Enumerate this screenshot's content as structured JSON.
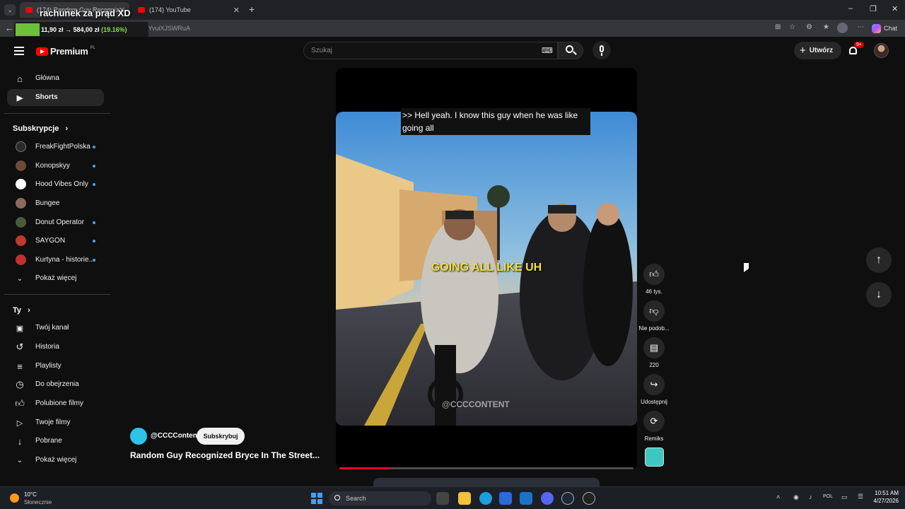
{
  "browser": {
    "tabs": [
      {
        "title": "(174) Random Guy Recogniz",
        "active": true
      },
      {
        "title": "(174) YouTube",
        "active": false
      }
    ],
    "new_tab": "+",
    "url": "/shorts/YvuiXJSWRuA",
    "chat_label": "Chat"
  },
  "overlay": {
    "title": "rachunek za prąd XD",
    "stats_a": "11,90 zł → 584,00 zł",
    "stats_pct": "(19.16%)",
    "progress_fraction": 0.19
  },
  "header": {
    "brand": "Premium",
    "brand_region": "PL",
    "search_placeholder": "Szukaj",
    "create_label": "Utwórz",
    "notif_count": "9+"
  },
  "sidebar": {
    "main": [
      {
        "label": "Główna",
        "icon": "home-icon"
      },
      {
        "label": "Shorts",
        "icon": "shorts-icon",
        "active": true
      }
    ],
    "subs_title": "Subskrypcje",
    "subs": [
      {
        "label": "FreakFightPolska",
        "color": "#2b2b2b",
        "dot": true
      },
      {
        "label": "Konopskyy",
        "color": "#6b4a3a",
        "dot": true
      },
      {
        "label": "Hood Vibes Only",
        "color": "#ffffff",
        "dot": true
      },
      {
        "label": "Bungee",
        "color": "#8a6a5a",
        "dot": false
      },
      {
        "label": "Donut Operator",
        "color": "#4a5a3a",
        "dot": true
      },
      {
        "label": "SAYGON",
        "color": "#c0392b",
        "dot": true
      },
      {
        "label": "Kurtyna - historie...",
        "color": "#c0302e",
        "dot": true
      }
    ],
    "show_more_subs": "Pokaż więcej",
    "you_title": "Ty",
    "you": [
      {
        "label": "Twój kanał",
        "icon": "channel-icon"
      },
      {
        "label": "Historia",
        "icon": "history-icon"
      },
      {
        "label": "Playlisty",
        "icon": "playlist-icon"
      },
      {
        "label": "Do obejrzenia",
        "icon": "watch-later-icon"
      },
      {
        "label": "Polubione filmy",
        "icon": "like-icon"
      },
      {
        "label": "Twoje filmy",
        "icon": "your-videos-icon"
      },
      {
        "label": "Pobrane",
        "icon": "download-icon"
      },
      {
        "label": "Pokaż więcej",
        "icon": "chevron-down-icon"
      }
    ]
  },
  "short": {
    "subtitle": ">> Hell yeah. I know this guy when he was like going all",
    "caption": "GOING ALL LIKE UH",
    "watermark": "@CCCCONTENT",
    "channel": "@CCCContent",
    "subscribe_label": "Subskrybuj",
    "title": "Random Guy Recognized Bryce In The Street...",
    "progress_fraction": 0.17,
    "actions": {
      "likes": "46 tys.",
      "dislike": "Nie podob...",
      "comments": "220",
      "share": "Udostępnij",
      "remix": "Remiks"
    }
  },
  "taskbar": {
    "temp": "10°C",
    "weather": "Słonecznie",
    "search": "Search",
    "lang": "POL",
    "time": "10:51 AM",
    "date": "4/27/2026"
  }
}
